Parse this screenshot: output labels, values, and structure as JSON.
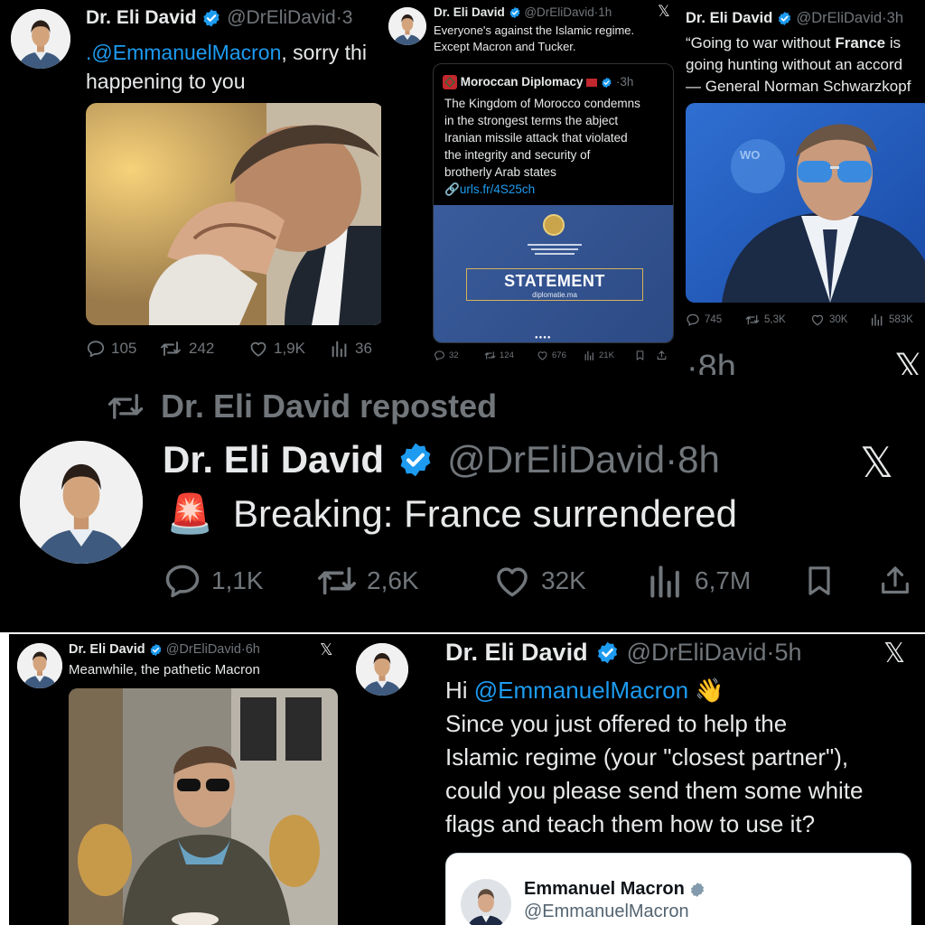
{
  "colors": {
    "background": "#000000",
    "text": "#e7e9ea",
    "muted": "#71767b",
    "link": "#1d9bf0",
    "verified": "#1d9bf0"
  },
  "tweet1": {
    "name": "Dr. Eli David",
    "handle": "@DrEliDavid",
    "time": "·3",
    "mention": ".@EmmanuelMacron",
    "text_after_mention": ", sorry thi",
    "text_line2": "happening to you",
    "replies": "105",
    "reposts": "242",
    "likes": "1,9K",
    "views": "36"
  },
  "tweet2": {
    "name": "Dr. Eli David",
    "handle": "@DrEliDavid",
    "time": "·1h",
    "text_line1": "Everyone's against the Islamic regime.",
    "text_line2": "Except Macron and Tucker.",
    "quote": {
      "name": "Moroccan Diplomacy",
      "time": "·3h",
      "lines": [
        "The Kingdom of Morocco condemns",
        "in the strongest terms the abject",
        "Iranian missile attack that violated",
        "the integrity and security of",
        "brotherly Arab states"
      ],
      "url": "urls.fr/4S25ch",
      "card_title": "STATEMENT",
      "card_sub": "diplomatie.ma"
    },
    "replies": "32",
    "reposts": "124",
    "likes": "676",
    "views": "21K"
  },
  "tweet3": {
    "name": "Dr. Eli David",
    "handle": "@DrEliDavid",
    "time": "·3h",
    "line1_pre": "“Going to war without ",
    "line1_bold": "France",
    "line1_post": " is",
    "line2": "going hunting without an accord",
    "line3": "— General Norman Schwarzkopf",
    "replies": "745",
    "reposts": "5,3K",
    "likes": "30K",
    "views": "583K"
  },
  "main_tweet": {
    "repost_label": "Dr. Eli David reposted",
    "name": "Dr. Eli David",
    "handle": "@DrEliDavid",
    "time": "·8h",
    "emoji": "🚨",
    "text": "Breaking: France surrendered",
    "replies": "1,1K",
    "reposts": "2,6K",
    "likes": "32K",
    "views": "6,7M"
  },
  "tweet4": {
    "name": "Dr. Eli David",
    "handle": "@DrEliDavid",
    "time": "·6h",
    "text": "Meanwhile, the pathetic Macron"
  },
  "tweet5": {
    "name": "Dr. Eli David",
    "handle": "@DrEliDavid",
    "time": "·5h",
    "greeting": "Hi ",
    "mention": "@EmmanuelMacron",
    "emoji": " 👋",
    "lines": [
      "Since you just offered to help the",
      "Islamic regime (your \"closest partner\"),",
      "could you please send them some white",
      "flags and teach them how to use it?"
    ],
    "quoted_name": "Emmanuel Macron",
    "quoted_handle": "@EmmanuelMacron"
  },
  "icons": {
    "reply": "reply-bubble-icon",
    "repost": "repost-arrows-icon",
    "like": "heart-icon",
    "views": "bar-chart-icon",
    "bookmark": "bookmark-icon",
    "share": "share-upload-icon",
    "x": "x-logo-icon",
    "verified": "verified-badge-icon"
  }
}
